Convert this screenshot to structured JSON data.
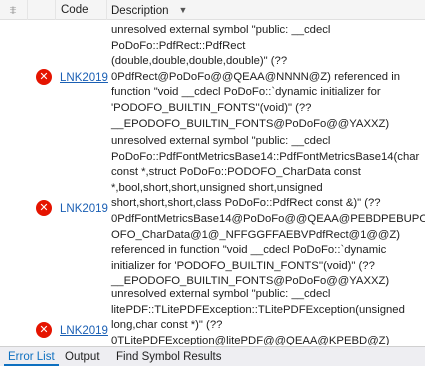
{
  "header": {
    "filter_icon": "filter-icon",
    "code_label": "Code",
    "description_label": "Description",
    "sort_glyph": "▼"
  },
  "rows": [
    {
      "icon": "error-icon",
      "code": "LNK2019",
      "description": "unresolved external symbol \"public: __cdecl\nPoDoFo::PdfRect::PdfRect\n(double,double,double,double)\" (??\n0PdfRect@PoDoFo@@QEAA@NNNN@Z) referenced in\nfunction \"void __cdecl PoDoFo::`dynamic initializer for\n'PODOFO_BUILTIN_FONTS''(void)\" (??\n__EPODOFO_BUILTIN_FONTS@PoDoFo@@YAXXZ)"
    },
    {
      "icon": "error-icon",
      "code": "LNK2019",
      "description": "unresolved external symbol \"public: __cdecl\nPoDoFo::PdfFontMetricsBase14::PdfFontMetricsBase14(char\nconst *,struct PoDoFo::PODOFO_CharData const\n*,bool,short,short,unsigned short,unsigned\nshort,short,short,class PoDoFo::PdfRect const &)\" (??\n0PdfFontMetricsBase14@PoDoFo@@QEAA@PEBDPEBUPOD\nOFO_CharData@1@_NFFGGFFAEBVPdfRect@1@@Z)\nreferenced in function \"void __cdecl PoDoFo::`dynamic\ninitializer for 'PODOFO_BUILTIN_FONTS''(void)\" (??\n__EPODOFO_BUILTIN_FONTS@PoDoFo@@YAXXZ)"
    },
    {
      "icon": "error-icon",
      "code": "LNK2019",
      "description": "unresolved external symbol \"public: __cdecl\nlitePDF::TLitePDFException::TLitePDFException(unsigned\nlong,char const *)\" (??\n0TLitePDFException@litePDF@@QEAA@KPEBD@Z)"
    }
  ],
  "tabs": [
    {
      "label": "Error List",
      "active": true
    },
    {
      "label": "Output",
      "active": false
    },
    {
      "label": "Find Symbol Results",
      "active": false
    }
  ],
  "colors": {
    "error_icon": "#e51400",
    "link": "#1a5fb4",
    "active_tab": "#0e70c0"
  }
}
